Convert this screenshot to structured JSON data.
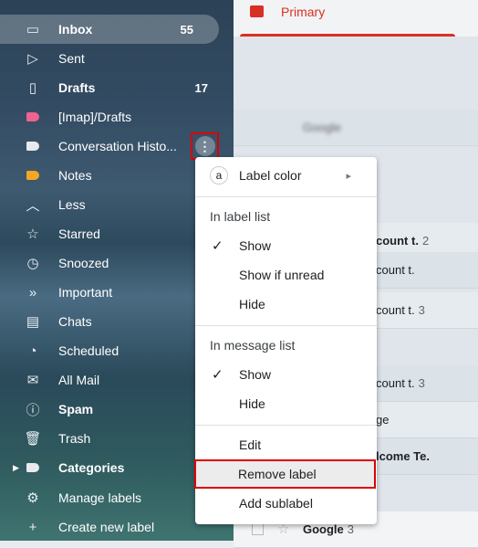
{
  "sidebar": {
    "items": [
      {
        "label": "Inbox",
        "count": "55",
        "icon": "inbox-icon"
      },
      {
        "label": "Sent",
        "icon": "send-icon"
      },
      {
        "label": "Drafts",
        "count": "17",
        "icon": "draft-icon"
      },
      {
        "label": "[Imap]/Drafts",
        "icon": "label-icon",
        "color": "#f06292"
      },
      {
        "label": "Conversation Histo...",
        "icon": "label-icon",
        "color": "#e8eaed"
      },
      {
        "label": "Notes",
        "icon": "label-icon",
        "color": "#f5a623"
      },
      {
        "label": "Less",
        "icon": "chevron-up-icon"
      },
      {
        "label": "Starred",
        "icon": "star-icon"
      },
      {
        "label": "Snoozed",
        "icon": "clock-icon"
      },
      {
        "label": "Important",
        "icon": "important-icon"
      },
      {
        "label": "Chats",
        "icon": "chat-icon"
      },
      {
        "label": "Scheduled",
        "icon": "scheduled-icon"
      },
      {
        "label": "All Mail",
        "icon": "mail-icon"
      },
      {
        "label": "Spam",
        "icon": "spam-icon"
      },
      {
        "label": "Trash",
        "icon": "trash-icon"
      },
      {
        "label": "Categories",
        "icon": "label-icon"
      },
      {
        "label": "Manage labels",
        "icon": "gear-icon"
      },
      {
        "label": "Create new label",
        "icon": "plus-icon"
      }
    ],
    "more_glyph": "⋮"
  },
  "tabs": {
    "primary": "Primary"
  },
  "rows": [
    {
      "text": "Google",
      "blur": true
    },
    {
      "text": "count t.",
      "count": "2",
      "bold": true
    },
    {
      "text": "count t."
    },
    {
      "text": "count t.",
      "count": "3"
    },
    {
      "text": "count t.",
      "count": "3"
    },
    {
      "text": "ge"
    },
    {
      "text": "lcome Te.",
      "bold": true
    },
    {
      "text": "Google",
      "count": "3",
      "bold": true
    }
  ],
  "menu": {
    "label_color": "Label color",
    "letter": "a",
    "in_label_list": "In label list",
    "show": "Show",
    "show_if_unread": "Show if unread",
    "hide": "Hide",
    "in_message_list": "In message list",
    "show2": "Show",
    "hide2": "Hide",
    "edit": "Edit",
    "remove_label": "Remove label",
    "add_sublabel": "Add sublabel",
    "check": "✓",
    "arrow": "▸"
  },
  "colors": {
    "accent": "#d93025",
    "highlight": "#dd0000"
  }
}
